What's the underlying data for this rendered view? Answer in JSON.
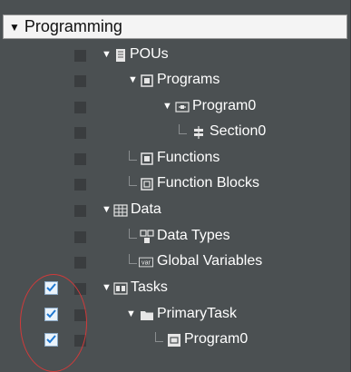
{
  "header": {
    "toggle_glyph": "▼",
    "title": "Programming"
  },
  "tree": {
    "pous": {
      "label": "POUs",
      "icon": "book-icon"
    },
    "programs": {
      "label": "Programs",
      "icon": "programs-folder-icon"
    },
    "program0": {
      "label": "Program0",
      "icon": "program-icon"
    },
    "section0": {
      "label": "Section0",
      "icon": "section-icon"
    },
    "functions": {
      "label": "Functions",
      "icon": "functions-icon"
    },
    "function_blocks": {
      "label": "Function Blocks",
      "icon": "function-blocks-icon"
    },
    "data": {
      "label": "Data",
      "icon": "table-icon"
    },
    "data_types": {
      "label": "Data Types",
      "icon": "data-types-icon"
    },
    "global_variables": {
      "label": "Global Variables",
      "icon": "var-icon",
      "icon_text": "var"
    },
    "tasks": {
      "label": "Tasks",
      "icon": "tasks-icon"
    },
    "primary_task": {
      "label": "PrimaryTask",
      "icon": "folder-icon"
    },
    "task_program0": {
      "label": "Program0",
      "icon": "program-ref-icon"
    }
  },
  "expand_glyph": "▼",
  "checked_rows": [
    "tasks",
    "primary_task",
    "task_program0"
  ],
  "colors": {
    "panel_bg": "#4b5052",
    "header_bg": "#f4f4f4",
    "highlight_oval": "#d23a3a",
    "check_mark": "#1f78d1"
  }
}
